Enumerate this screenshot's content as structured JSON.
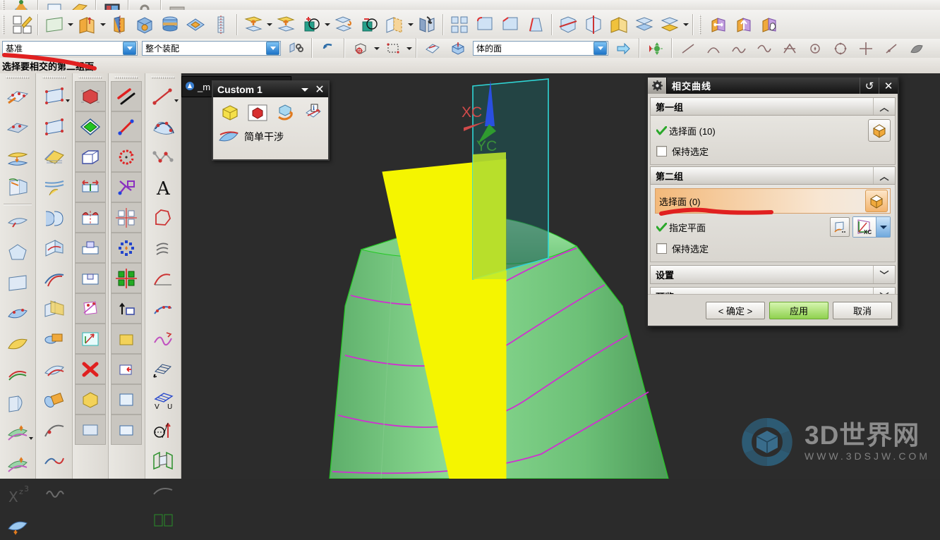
{
  "window": {
    "background_window_title": "_m"
  },
  "toolbars": {
    "row0_items": [
      {
        "name": "sketch-in-task-env-icon"
      },
      {
        "name": "finish-sketch-icon"
      },
      {
        "name": "display-shading-icon"
      },
      {
        "name": "settings-small-icon"
      },
      {
        "name": "bar-icon"
      },
      {
        "name": "panel-icon"
      }
    ],
    "row1_items": [
      {
        "name": "sketch-icon"
      },
      {
        "name": "datum-plane-icon"
      },
      {
        "name": "extrude-icon"
      },
      {
        "name": "revolve-icon"
      },
      {
        "name": "block-icon"
      },
      {
        "name": "cylinder-icon"
      },
      {
        "name": "boss-icon"
      },
      {
        "name": "thread-icon"
      },
      {
        "name": "extrude-face-icon"
      },
      {
        "name": "offset-face-icon"
      },
      {
        "name": "unite-icon"
      },
      {
        "name": "subtract-icon"
      },
      {
        "name": "intersect-icon"
      },
      {
        "name": "shell-icon"
      },
      {
        "name": "mirror-feature-icon"
      },
      {
        "name": "pattern-feature-icon"
      },
      {
        "name": "edge-blend-icon"
      },
      {
        "name": "chamfer-icon"
      },
      {
        "name": "draft-icon"
      },
      {
        "name": "trim-body-icon"
      },
      {
        "name": "split-body-icon"
      },
      {
        "name": "sew-icon"
      },
      {
        "name": "thicken-icon"
      },
      {
        "name": "offset-surface-icon"
      },
      {
        "name": "move-object-icon"
      },
      {
        "name": "rotate-object-icon"
      },
      {
        "name": "copy-object-icon"
      }
    ]
  },
  "filterbar": {
    "datum_filter": "基准",
    "assembly_scope": "整个装配",
    "body_face_filter": "体的面",
    "icons": [
      {
        "name": "assembly-scope-icon"
      },
      {
        "name": "undo-icon"
      },
      {
        "name": "snap-point-icon"
      },
      {
        "name": "snap-dropdown-icon"
      },
      {
        "name": "rectangle-select-icon"
      },
      {
        "name": "select-options-icon"
      },
      {
        "name": "face-select-icon"
      },
      {
        "name": "face-of-body-icon"
      },
      {
        "name": "apply-arrow-icon"
      },
      {
        "name": "move-view-icon"
      },
      {
        "name": "line-icon"
      },
      {
        "name": "arc-icon"
      },
      {
        "name": "spline-icon"
      },
      {
        "name": "curve-icon"
      },
      {
        "name": "helix-icon"
      },
      {
        "name": "point-icon"
      },
      {
        "name": "circle-icon"
      },
      {
        "name": "cross-icon"
      },
      {
        "name": "line2-icon"
      },
      {
        "name": "surface-icon"
      }
    ]
  },
  "status": {
    "message": "选择要相交的第二组面"
  },
  "left_palettes": [
    {
      "name": "surface-palette",
      "items": [
        {
          "name": "through-curves-icon"
        },
        {
          "name": "through-curve-mesh-icon"
        },
        {
          "name": "ruled-surface-icon"
        },
        {
          "name": "swept-icon"
        },
        {
          "name": "divider"
        },
        {
          "name": "section-surface-icon"
        },
        {
          "name": "n-sided-surface-icon"
        },
        {
          "name": "bounded-plane-icon"
        },
        {
          "name": "studio-surface-icon"
        },
        {
          "name": "transition-icon"
        },
        {
          "name": "law-extension-icon"
        },
        {
          "name": "silhouette-flange-icon"
        },
        {
          "name": "offset-surface-icon"
        },
        {
          "name": "rough-offset-icon"
        },
        {
          "name": "x-form-icon"
        },
        {
          "name": "enlarge-icon"
        }
      ]
    },
    {
      "name": "curve-palette",
      "items": [
        {
          "name": "rectangle-icon",
          "has_caret": true
        },
        {
          "name": "polygon-icon"
        },
        {
          "name": "bridge-curve-icon"
        },
        {
          "name": "offset-curve-icon"
        },
        {
          "name": "extract-curve-icon"
        },
        {
          "name": "project-curve-icon"
        },
        {
          "name": "combined-projection-icon"
        },
        {
          "name": "intersection-curve-icon"
        },
        {
          "name": "section-curve-icon"
        },
        {
          "name": "isocline-curve-icon"
        },
        {
          "name": "wrap-unwrap-icon"
        },
        {
          "name": "simplify-curve-icon"
        },
        {
          "name": "join-curve-icon"
        },
        {
          "name": "spring-curve-icon"
        }
      ]
    },
    {
      "name": "feature-palette",
      "items": [
        {
          "name": "solid-body-icon"
        },
        {
          "name": "sheet-body-icon"
        },
        {
          "name": "block-icon"
        },
        {
          "name": "mirror-body-icon"
        },
        {
          "name": "pattern-face-icon"
        },
        {
          "name": "pad-icon"
        },
        {
          "name": "groove-icon"
        },
        {
          "name": "datum-csys-icon"
        },
        {
          "name": "delete-face-icon"
        },
        {
          "name": "replace-face-icon"
        },
        {
          "name": "move-face-icon"
        },
        {
          "name": "resize-face-icon"
        }
      ]
    },
    {
      "name": "line-palette",
      "items": [
        {
          "name": "parallel-lines-icon"
        },
        {
          "name": "line-endpoints-icon"
        },
        {
          "name": "arc-rotate-icon"
        },
        {
          "name": "angle-constraint-icon"
        },
        {
          "name": "pattern-grid-icon"
        },
        {
          "name": "point-set-icon"
        },
        {
          "name": "circular-pattern-icon"
        },
        {
          "name": "mirror-pattern-icon"
        },
        {
          "name": "translate-icon"
        },
        {
          "name": "scale-icon"
        },
        {
          "name": "quad-pattern-icon"
        },
        {
          "name": "extrude-up-icon"
        }
      ]
    },
    {
      "name": "analysis-palette",
      "items": [
        {
          "name": "line-caret-icon",
          "has_caret": true
        },
        {
          "name": "studio-spline-icon"
        },
        {
          "name": "polyline-icon"
        },
        {
          "name": "text-icon"
        },
        {
          "name": "profile-icon"
        },
        {
          "name": "helix-icon"
        },
        {
          "name": "law-curve-icon"
        },
        {
          "name": "fit-curve-icon"
        },
        {
          "name": "smooth-curve-icon"
        },
        {
          "name": "isoparametric-curve-icon"
        },
        {
          "name": "section-analysis-icon"
        },
        {
          "name": "deviation-gauge-icon"
        },
        {
          "name": "uv-grid-icon"
        },
        {
          "name": "reflection-icon"
        },
        {
          "name": "assembly-compare-icon"
        }
      ]
    }
  ],
  "custom_toolbar": {
    "title": "Custom 1",
    "buttons": [
      {
        "name": "yellow-cube-icon"
      },
      {
        "name": "red-cube-icon"
      },
      {
        "name": "rotate-body-icon"
      },
      {
        "name": "info-body-icon"
      }
    ],
    "label_item": {
      "name": "simple-interference-item",
      "label": "简单干涉"
    },
    "caret_name": "chevron-down-icon",
    "close_name": "close-icon"
  },
  "dialog": {
    "title": "相交曲线",
    "titlebar_icons": {
      "gear": "gear-icon",
      "reset": "reset-icon",
      "close": "close-icon"
    },
    "groups": [
      {
        "name": "first-group",
        "header": "第一组",
        "chevron": "chevron-up-icon",
        "expanded": true,
        "rows": [
          {
            "type": "select",
            "label": "选择面 (10)",
            "checked": true,
            "button": "select-face-button",
            "highlighted": false
          },
          {
            "type": "checkbox",
            "label": "保持选定",
            "checked": false
          }
        ]
      },
      {
        "name": "second-group",
        "header": "第二组",
        "chevron": "chevron-up-icon",
        "expanded": true,
        "rows": [
          {
            "type": "select",
            "label": "选择面 (0)",
            "checked": false,
            "button": "select-face-button",
            "highlighted": true
          },
          {
            "type": "plane",
            "label": "指定平面",
            "checked": true,
            "dialog_button": "plane-dialog-button",
            "plane_button": "xc-plane-button",
            "plane_button_label": "XC"
          },
          {
            "type": "checkbox",
            "label": "保持选定",
            "checked": false
          }
        ]
      }
    ],
    "collapsed_sections": [
      {
        "name": "settings-section",
        "header": "设置",
        "chevron": "chevron-down-icon"
      },
      {
        "name": "preview-section",
        "header": "预览",
        "chevron": "chevron-down-icon"
      }
    ],
    "footer_buttons": [
      {
        "name": "ok-button",
        "label": "< 确定 >",
        "primary": false
      },
      {
        "name": "apply-button",
        "label": "应用",
        "primary": true
      },
      {
        "name": "cancel-button",
        "label": "取消",
        "primary": false
      }
    ]
  },
  "viewport": {
    "axis_labels": [
      {
        "name": "xc-axis-label",
        "text": "XC",
        "color": "#d14a4a"
      },
      {
        "name": "yc-axis-label",
        "text": "YC",
        "color": "#3a8f3a"
      }
    ],
    "colors": {
      "background": "#2c2c2c",
      "selected_face": "#f5f500",
      "body": "#77d07e",
      "datum_plane": "#2fb9b9",
      "intersection_curve": "#d02fd0",
      "z_axis": "#2a4fe0"
    }
  },
  "annotations": [
    {
      "name": "red-marker-datum-filter"
    },
    {
      "name": "red-marker-select-face"
    }
  ],
  "watermark": {
    "main": "3D世界网",
    "sub": "WWW.3DSJW.COM",
    "logo_name": "3dsjw-logo-icon"
  }
}
